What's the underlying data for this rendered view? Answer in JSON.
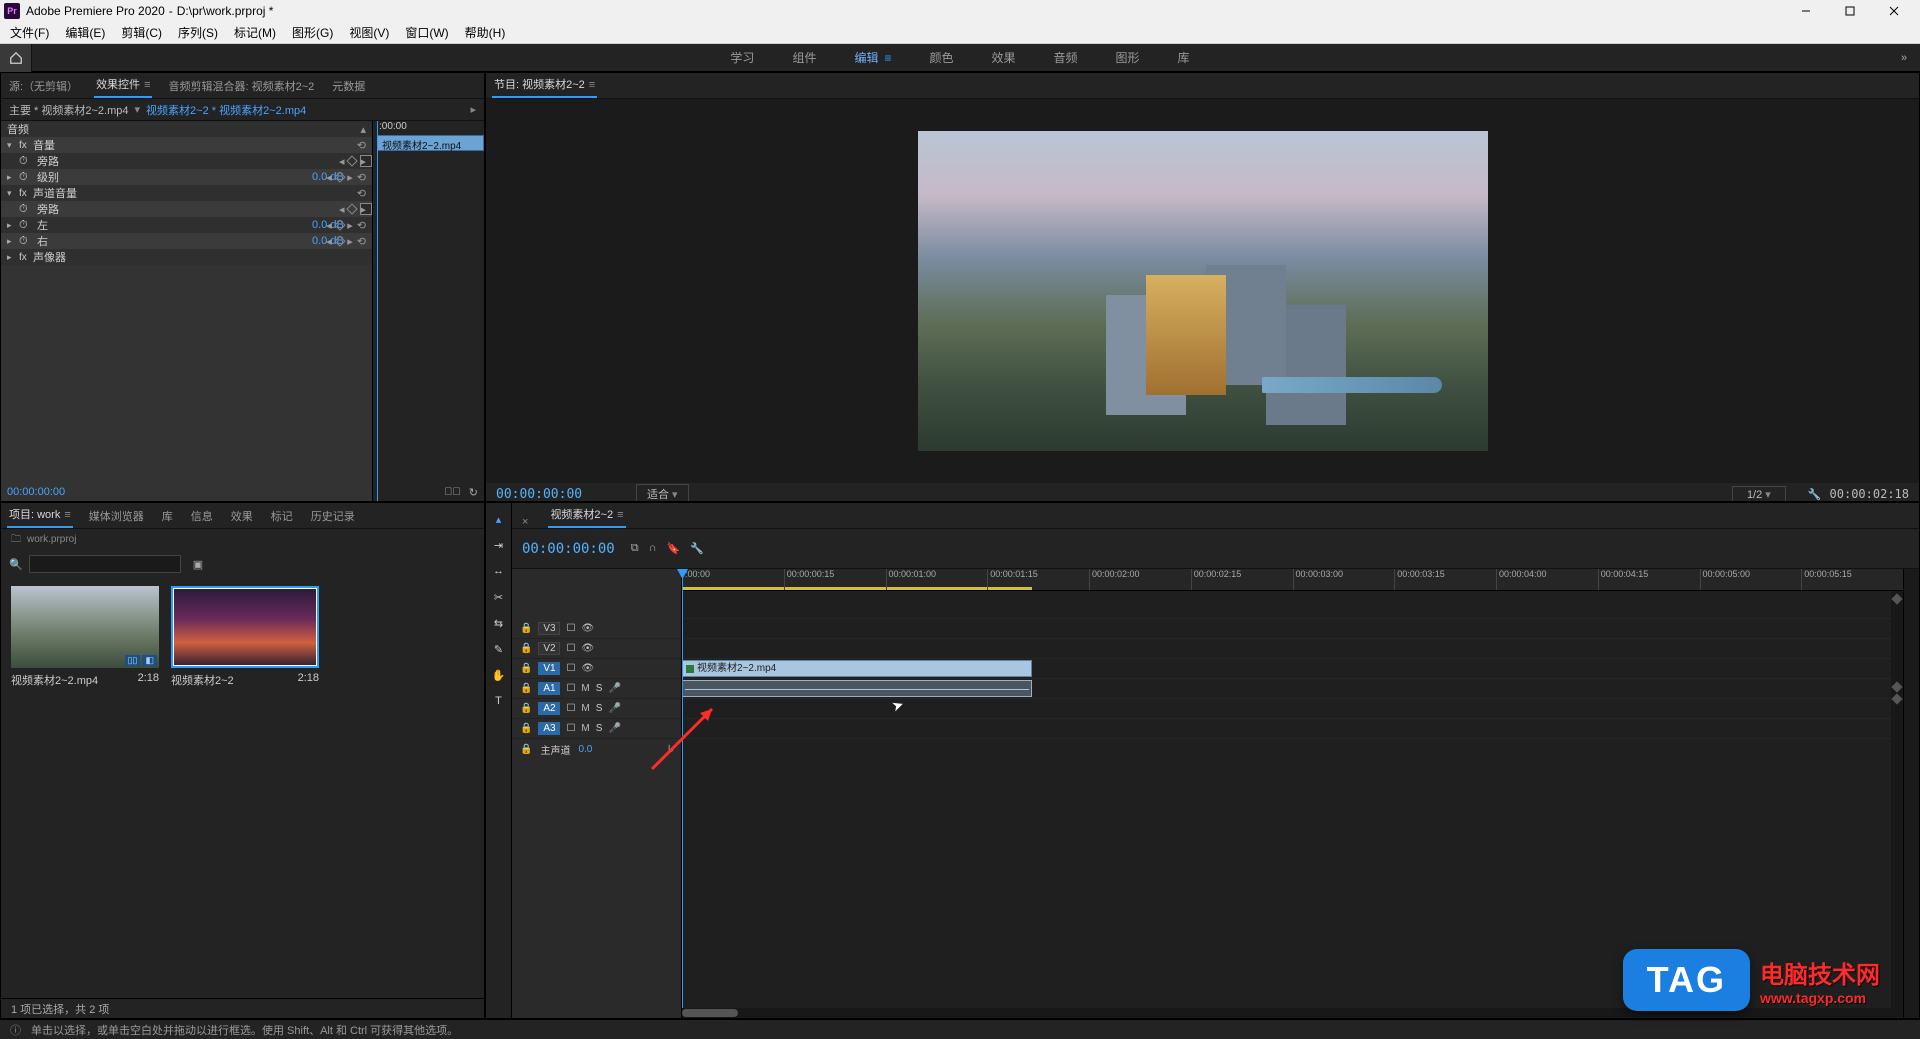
{
  "titlebar": {
    "app": "Adobe Premiere Pro 2020",
    "project_path": "D:\\pr\\work.prproj *"
  },
  "menubar": [
    "文件(F)",
    "编辑(E)",
    "剪辑(C)",
    "序列(S)",
    "标记(M)",
    "图形(G)",
    "视图(V)",
    "窗口(W)",
    "帮助(H)"
  ],
  "workspaces": {
    "items": [
      "学习",
      "组件",
      "编辑",
      "颜色",
      "效果",
      "音频",
      "图形",
      "库"
    ],
    "active": "编辑"
  },
  "source_tabs": {
    "items": [
      "源:（无剪辑）",
      "效果控件",
      "音频剪辑混合器: 视频素材2~2",
      "元数据"
    ],
    "active": "效果控件"
  },
  "effect_controls": {
    "breadcrumb_main": "主要 * 视频素材2~2.mp4",
    "breadcrumb_link": "视频素材2~2 * 视频素材2~2.mp4",
    "timeline_tc": ":00:00",
    "clip_chip": "视频素材2~2.mp4",
    "section_audio": "音频",
    "volume": {
      "label": "音量",
      "bypass": "旁路",
      "level": "级别",
      "level_val": "0.0 dB"
    },
    "channel": {
      "label": "声道音量",
      "bypass": "旁路",
      "left": "左",
      "right": "右",
      "val": "0.0 dB"
    },
    "panner": "声像器",
    "foot_tc": "00:00:00:00"
  },
  "program": {
    "tab": "节目: 视频素材2~2",
    "tc_left": "00:00:00:00",
    "fit": "适合",
    "half": "1/2",
    "tc_right": "00:00:02:18"
  },
  "project_tabs": {
    "items": [
      "项目: work",
      "媒体浏览器",
      "库",
      "信息",
      "效果",
      "标记",
      "历史记录"
    ],
    "active": "项目: work"
  },
  "project": {
    "crumb": "work.prproj",
    "search_icon": "⌕",
    "status": "1 项已选择，共 2 项",
    "items": [
      {
        "name": "视频素材2~2.mp4",
        "dur": "2:18",
        "badges": [
          "▯▯",
          "◧"
        ]
      },
      {
        "name": "视频素材2~2",
        "dur": "2:18",
        "badges": []
      }
    ]
  },
  "timeline": {
    "tab": "视频素材2~2",
    "tc": "00:00:00:00",
    "ruler": [
      ":00:00",
      "00:00:00:15",
      "00:00:01:00",
      "00:00:01:15",
      "00:00:02:00",
      "00:00:02:15",
      "00:00:03:00",
      "00:00:03:15",
      "00:00:04:00",
      "00:00:04:15",
      "00:00:05:00",
      "00:00:05:15"
    ],
    "tracks": {
      "v": [
        "V3",
        "V2",
        "V1"
      ],
      "a": [
        "A1",
        "A2",
        "A3"
      ],
      "master": "主声道",
      "master_val": "0.0"
    },
    "clip_v1": "视频素材2~2.mp4"
  },
  "statusbar": "单击以选择，或单击空白处并拖动以进行框选。使用 Shift、Alt 和 Ctrl 可获得其他选项。",
  "watermark": {
    "tag": "TAG",
    "line1": "电脑技术网",
    "line2": "www.tagxp.com"
  }
}
